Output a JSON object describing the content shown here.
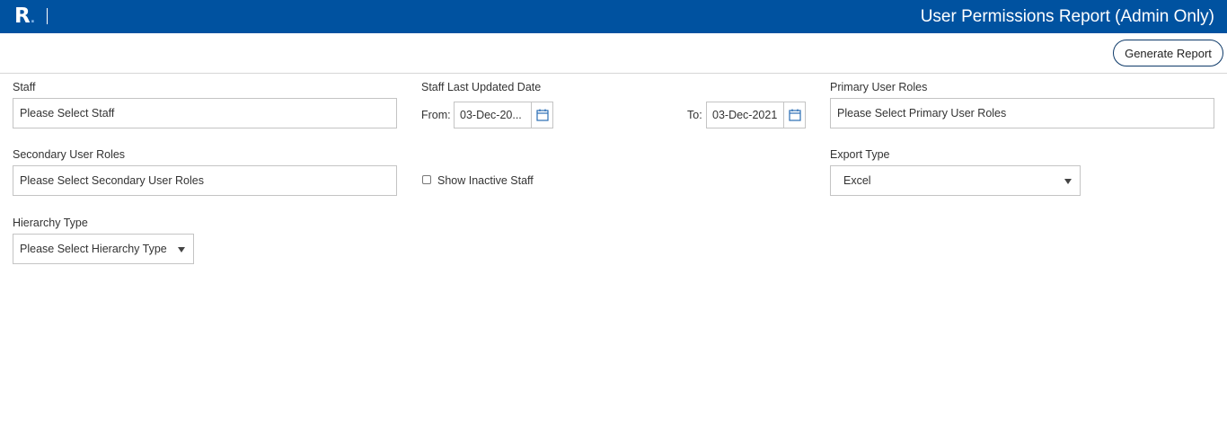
{
  "header": {
    "logo_letter": "R",
    "logo_dot": ".",
    "title": "User Permissions Report (Admin Only)"
  },
  "toolbar": {
    "generate_label": "Generate Report"
  },
  "form": {
    "staff": {
      "label": "Staff",
      "placeholder": "Please Select Staff"
    },
    "last_updated": {
      "label": "Staff Last Updated Date",
      "from_label": "From:",
      "from_value": "03-Dec-20...",
      "to_label": "To:",
      "to_value": "03-Dec-2021"
    },
    "primary_roles": {
      "label": "Primary User Roles",
      "placeholder": "Please Select Primary User Roles"
    },
    "secondary_roles": {
      "label": "Secondary User Roles",
      "placeholder": "Please Select Secondary User Roles"
    },
    "show_inactive": {
      "label": "Show Inactive Staff",
      "checked": false
    },
    "export_type": {
      "label": "Export Type",
      "value": "Excel"
    },
    "hierarchy_type": {
      "label": "Hierarchy Type",
      "placeholder": "Please Select Hierarchy Type"
    }
  },
  "colors": {
    "header_bg": "#0052a0",
    "button_border": "#0e3a69",
    "calendar_icon": "#2a6db5"
  },
  "icons": {
    "calendar": "calendar-icon",
    "dropdown": "chevron-down-icon"
  }
}
